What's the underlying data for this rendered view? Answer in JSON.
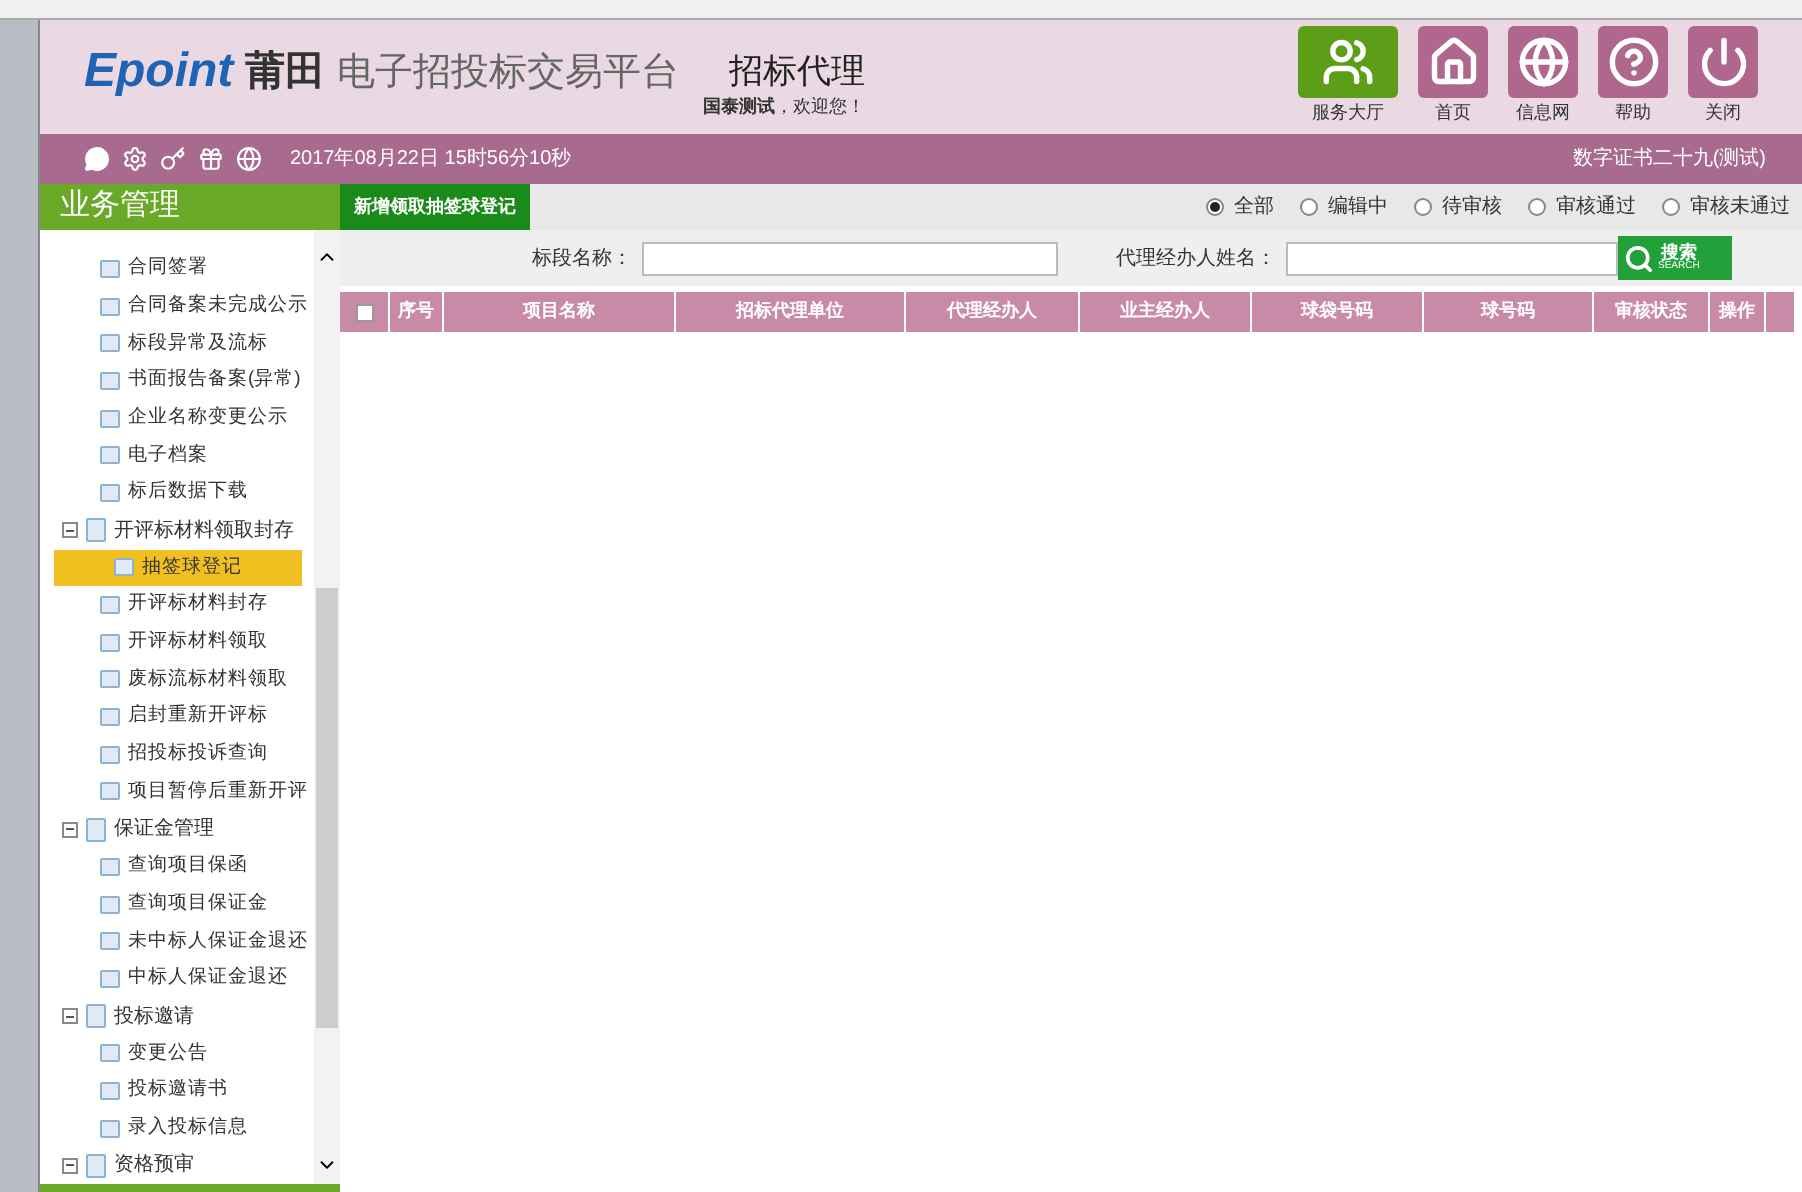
{
  "header": {
    "brand": "Epoint",
    "city": "莆田",
    "platform": "电子招投标交易平台",
    "role": "招标代理",
    "user": "国泰测试",
    "welcome": "，欢迎您！",
    "nav": [
      {
        "kind": "hall",
        "label": "服务大厅"
      },
      {
        "kind": "home",
        "label": "首页"
      },
      {
        "kind": "globe",
        "label": "信息网"
      },
      {
        "kind": "help",
        "label": "帮助"
      },
      {
        "kind": "power",
        "label": "关闭"
      }
    ]
  },
  "status_bar": {
    "datetime": "2017年08月22日 15时56分10秒",
    "certificate": "数字证书二十九(测试)"
  },
  "sidebar": {
    "title": "业务管理",
    "items": [
      {
        "kind": "page",
        "label": "合同签署",
        "selected": false
      },
      {
        "kind": "page",
        "label": "合同备案未完成公示",
        "selected": false
      },
      {
        "kind": "page",
        "label": "标段异常及流标",
        "selected": false
      },
      {
        "kind": "page",
        "label": "书面报告备案(异常)",
        "selected": false
      },
      {
        "kind": "page",
        "label": "企业名称变更公示",
        "selected": false
      },
      {
        "kind": "page",
        "label": "电子档案",
        "selected": false
      },
      {
        "kind": "page",
        "label": "标后数据下载",
        "selected": false
      },
      {
        "kind": "group",
        "label": "开评标材料领取封存",
        "expanded": true,
        "children": [
          {
            "kind": "page",
            "label": "抽签球登记",
            "selected": true
          },
          {
            "kind": "page",
            "label": "开评标材料封存",
            "selected": false
          },
          {
            "kind": "page",
            "label": "开评标材料领取",
            "selected": false
          },
          {
            "kind": "page",
            "label": "废标流标材料领取",
            "selected": false
          },
          {
            "kind": "page",
            "label": "启封重新开评标",
            "selected": false
          },
          {
            "kind": "page",
            "label": "招投标投诉查询",
            "selected": false
          },
          {
            "kind": "page",
            "label": "项目暂停后重新开评",
            "selected": false
          }
        ]
      },
      {
        "kind": "group",
        "label": "保证金管理",
        "expanded": true,
        "children": [
          {
            "kind": "page",
            "label": "查询项目保函",
            "selected": false
          },
          {
            "kind": "page",
            "label": "查询项目保证金",
            "selected": false
          },
          {
            "kind": "page",
            "label": "未中标人保证金退还",
            "selected": false
          },
          {
            "kind": "page",
            "label": "中标人保证金退还",
            "selected": false
          }
        ]
      },
      {
        "kind": "group",
        "label": "投标邀请",
        "expanded": true,
        "children": [
          {
            "kind": "page",
            "label": "变更公告",
            "selected": false
          },
          {
            "kind": "page",
            "label": "投标邀请书",
            "selected": false
          },
          {
            "kind": "page",
            "label": "录入投标信息",
            "selected": false
          }
        ]
      },
      {
        "kind": "group",
        "label": "资格预审",
        "expanded": true
      }
    ]
  },
  "tab": {
    "label": "新增领取抽签球登记"
  },
  "filters": [
    {
      "label": "全部",
      "selected": true
    },
    {
      "label": "编辑中",
      "selected": false
    },
    {
      "label": "待审核",
      "selected": false
    },
    {
      "label": "审核通过",
      "selected": false
    },
    {
      "label": "审核未通过",
      "selected": false
    }
  ],
  "search": {
    "fields": [
      {
        "label": "标段名称："
      },
      {
        "label": "代理经办人姓名："
      }
    ],
    "button": "搜索",
    "button_sub": "SEARCH"
  },
  "table": {
    "select_all": {
      "checked": false
    },
    "columns": [
      "序号",
      "项目名称",
      "招标代理单位",
      "代理经办人",
      "业主经办人",
      "球袋号码",
      "球号码",
      "审核状态",
      "操作"
    ]
  }
}
